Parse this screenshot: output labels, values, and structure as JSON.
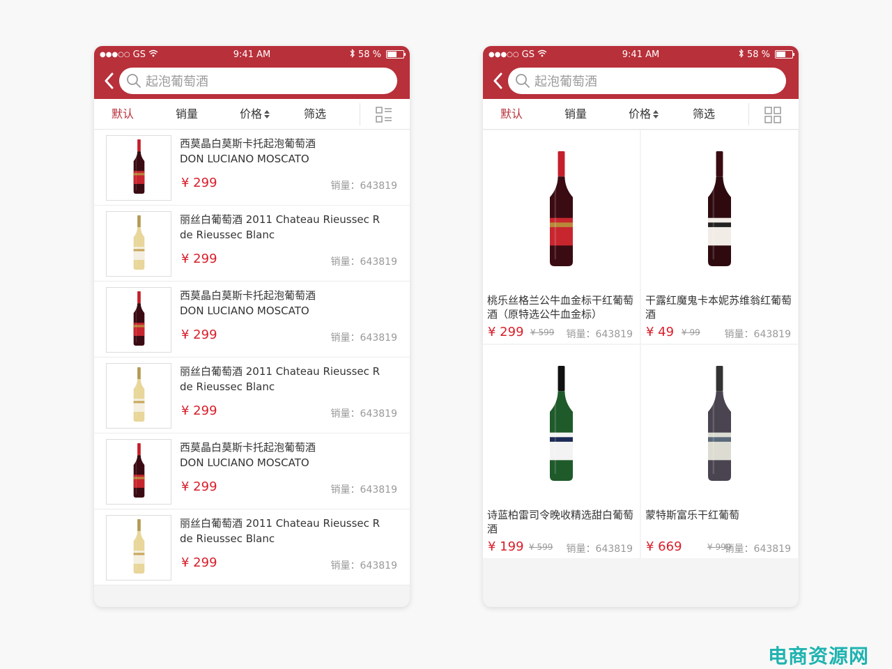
{
  "status": {
    "carrier": "GS",
    "time": "9:41 AM",
    "battery": "58 %",
    "battery_level": 0.58
  },
  "search": {
    "placeholder": "起泡葡萄酒"
  },
  "sort": {
    "default": "默认",
    "sales": "销量",
    "price": "价格",
    "filter": "筛选"
  },
  "list_items": [
    {
      "title_cn": "西莫晶白莫斯卡托起泡葡萄酒",
      "title_en": "DON LUCIANO MOSCATO",
      "price": "¥ 299",
      "sales": "销量：643819",
      "wine": "red"
    },
    {
      "title_cn": "丽丝白葡萄酒 2011 Chateau Rieussec R",
      "title_en": "de Rieussec Blanc",
      "price": "¥ 299",
      "sales": "销量：643819",
      "wine": "white"
    },
    {
      "title_cn": "西莫晶白莫斯卡托起泡葡萄酒",
      "title_en": "DON LUCIANO MOSCATO",
      "price": "¥ 299",
      "sales": "销量：643819",
      "wine": "red"
    },
    {
      "title_cn": "丽丝白葡萄酒 2011 Chateau Rieussec R",
      "title_en": "de Rieussec Blanc",
      "price": "¥ 299",
      "sales": "销量：643819",
      "wine": "white"
    },
    {
      "title_cn": "西莫晶白莫斯卡托起泡葡萄酒",
      "title_en": "DON LUCIANO MOSCATO",
      "price": "¥ 299",
      "sales": "销量：643819",
      "wine": "red"
    },
    {
      "title_cn": "丽丝白葡萄酒 2011 Chateau Rieussec R",
      "title_en": "de Rieussec Blanc",
      "price": "¥ 299",
      "sales": "销量：643819",
      "wine": "white"
    }
  ],
  "grid_items": [
    {
      "title": "桃乐丝格兰公牛血金标干红葡萄酒（原特选公牛血金标）",
      "price": "¥ 299",
      "old_price": "¥ 599",
      "sales": "销量：643819"
    },
    {
      "title": "干露红魔鬼卡本妮苏维翁红葡萄酒",
      "price": "¥ 49",
      "old_price": "¥ 99",
      "sales": "销量：643819"
    },
    {
      "title": "诗蓝柏雷司令晚收精选甜白葡萄酒",
      "price": "¥ 199",
      "old_price": "¥ 599",
      "sales": "销量：643819"
    },
    {
      "title": "蒙特斯富乐干红葡萄",
      "price": "¥ 669",
      "old_price": "¥ 999",
      "sales": "销量：643819"
    }
  ],
  "watermark": "电商资源网",
  "colors": {
    "brand": "#b8303a",
    "price": "#d81e2a"
  }
}
